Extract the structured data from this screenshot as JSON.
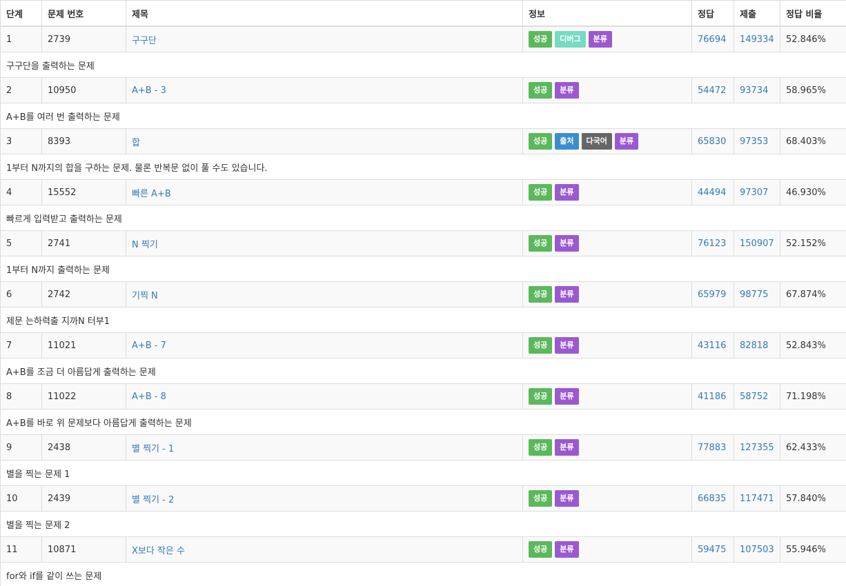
{
  "table": {
    "headers": [
      "단계",
      "문제 번호",
      "제목",
      "정보",
      "정답",
      "제출",
      "정답 비율"
    ],
    "rows": [
      {
        "step": "1",
        "number": "2739",
        "title": "구구단",
        "badges": [
          {
            "label": "성공",
            "type": "success"
          },
          {
            "label": "디버그",
            "type": "debug"
          },
          {
            "label": "분류",
            "type": "category"
          }
        ],
        "accepted": "76694",
        "submissions": "149334",
        "ratio": "52.846%",
        "description": "구구단을 출력하는 문제"
      },
      {
        "step": "2",
        "number": "10950",
        "title": "A+B - 3",
        "badges": [
          {
            "label": "성공",
            "type": "success"
          },
          {
            "label": "분류",
            "type": "category"
          }
        ],
        "accepted": "54472",
        "submissions": "93734",
        "ratio": "58.965%",
        "description": "A+B를 여러 번 출력하는 문제"
      },
      {
        "step": "3",
        "number": "8393",
        "title": "합",
        "badges": [
          {
            "label": "성공",
            "type": "success"
          },
          {
            "label": "출처",
            "type": "source"
          },
          {
            "label": "다국어",
            "type": "multilang"
          },
          {
            "label": "분류",
            "type": "category"
          }
        ],
        "accepted": "65830",
        "submissions": "97353",
        "ratio": "68.403%",
        "description": "1부터 N까지의 합을 구하는 문제. 물론 반복문 없이 풀 수도 있습니다."
      },
      {
        "step": "4",
        "number": "15552",
        "title": "빠른 A+B",
        "badges": [
          {
            "label": "성공",
            "type": "success"
          },
          {
            "label": "분류",
            "type": "category"
          }
        ],
        "accepted": "44494",
        "submissions": "97307",
        "ratio": "46.930%",
        "description": "빠르게 입력받고 출력하는 문제"
      },
      {
        "step": "5",
        "number": "2741",
        "title": "N 찍기",
        "badges": [
          {
            "label": "성공",
            "type": "success"
          },
          {
            "label": "분류",
            "type": "category"
          }
        ],
        "accepted": "76123",
        "submissions": "150907",
        "ratio": "52.152%",
        "description": "1부터 N까지 출력하는 문제"
      },
      {
        "step": "6",
        "number": "2742",
        "title": "기찍 N",
        "badges": [
          {
            "label": "성공",
            "type": "success"
          },
          {
            "label": "분류",
            "type": "category"
          }
        ],
        "accepted": "65979",
        "submissions": "98775",
        "ratio": "67.874%",
        "description": "제문 는하력출 지까N 터부1"
      },
      {
        "step": "7",
        "number": "11021",
        "title": "A+B - 7",
        "badges": [
          {
            "label": "성공",
            "type": "success"
          },
          {
            "label": "분류",
            "type": "category"
          }
        ],
        "accepted": "43116",
        "submissions": "82818",
        "ratio": "52.843%",
        "description": "A+B를 조금 더 아름답게 출력하는 문제"
      },
      {
        "step": "8",
        "number": "11022",
        "title": "A+B - 8",
        "badges": [
          {
            "label": "성공",
            "type": "success"
          },
          {
            "label": "분류",
            "type": "category"
          }
        ],
        "accepted": "41186",
        "submissions": "58752",
        "ratio": "71.198%",
        "description": "A+B를 바로 위 문제보다 아름답게 출력하는 문제"
      },
      {
        "step": "9",
        "number": "2438",
        "title": "별 찍기 - 1",
        "badges": [
          {
            "label": "성공",
            "type": "success"
          },
          {
            "label": "분류",
            "type": "category"
          }
        ],
        "accepted": "77883",
        "submissions": "127355",
        "ratio": "62.433%",
        "description": "별을 찍는 문제 1"
      },
      {
        "step": "10",
        "number": "2439",
        "title": "별 찍기 - 2",
        "badges": [
          {
            "label": "성공",
            "type": "success"
          },
          {
            "label": "분류",
            "type": "category"
          }
        ],
        "accepted": "66835",
        "submissions": "117471",
        "ratio": "57.840%",
        "description": "별을 찍는 문제 2"
      },
      {
        "step": "11",
        "number": "10871",
        "title": "X보다 작은 수",
        "badges": [
          {
            "label": "성공",
            "type": "success"
          },
          {
            "label": "분류",
            "type": "category"
          }
        ],
        "accepted": "59475",
        "submissions": "107503",
        "ratio": "55.946%",
        "description": "for와 if를 같이 쓰는 문제"
      }
    ]
  },
  "colors": {
    "link": "#337ab7",
    "success": "#5cb85c",
    "debug": "#77dbc4",
    "category": "#9b59d0",
    "source": "#3c8dcc",
    "multilang": "#666666"
  }
}
